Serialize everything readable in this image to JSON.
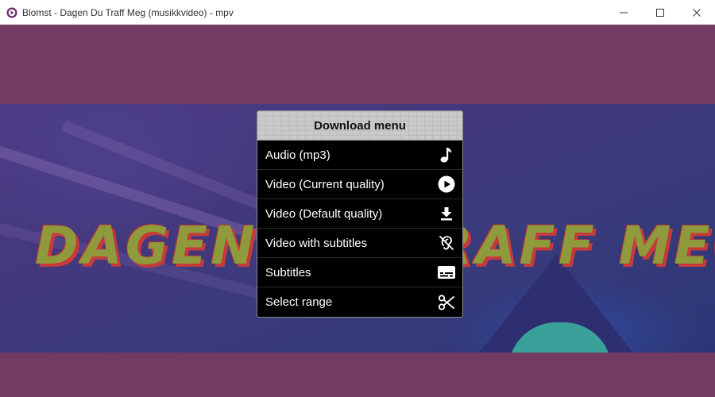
{
  "window": {
    "title": "Blomst - Dagen Du Traff Meg (musikkvideo) - mpv",
    "app_icon": "mpv-icon",
    "controls": [
      {
        "name": "minimize-icon"
      },
      {
        "name": "maximize-icon"
      },
      {
        "name": "close-icon"
      }
    ]
  },
  "video": {
    "frame_text": "DAGEN DU TRAFF MEG",
    "background_color": "#733a63"
  },
  "menu": {
    "header": "Download menu",
    "items": [
      {
        "label": "Audio (mp3)",
        "icon": "music-note-icon"
      },
      {
        "label": "Video (Current quality)",
        "icon": "play-circle-icon"
      },
      {
        "label": "Video (Default quality)",
        "icon": "download-icon"
      },
      {
        "label": "Video with subtitles",
        "icon": "hearing-disabled-icon"
      },
      {
        "label": "Subtitles",
        "icon": "subtitles-icon"
      },
      {
        "label": "Select range",
        "icon": "scissors-icon"
      }
    ]
  }
}
